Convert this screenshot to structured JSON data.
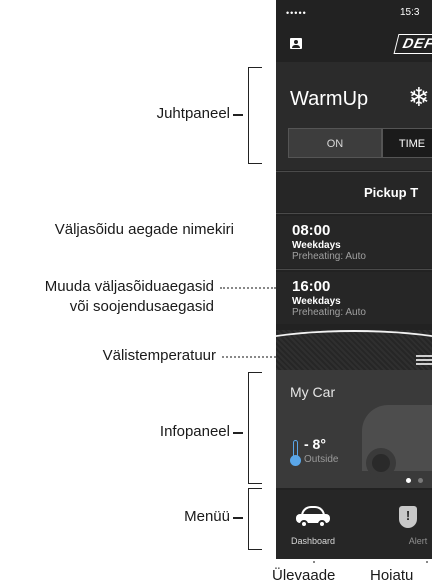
{
  "callouts": {
    "control_panel": "Juhtpaneel",
    "departure_list": "Väljasõidu aegade nimekiri",
    "edit_times_line1": "Muuda väljasõiduaegasid",
    "edit_times_line2": "või soojendusaegasid",
    "outside_temp": "Välistemperatuur",
    "info_panel": "Infopaneel",
    "menu": "Menüü",
    "overview": "Ülevaade",
    "alerts": "Hoiatu"
  },
  "phone": {
    "status": {
      "signal": "•••••",
      "time": "15:3"
    },
    "brand_logo": "DEF",
    "control": {
      "title": "WarmUp",
      "on_label": "ON",
      "timer_label": "TIME"
    },
    "pickup_header": "Pickup T",
    "departures": [
      {
        "time": "08:00",
        "days": "Weekdays",
        "preheat": "Preheating: Auto"
      },
      {
        "time": "16:00",
        "days": "Weekdays",
        "preheat": "Preheating: Auto"
      }
    ],
    "info": {
      "car_name": "My Car",
      "temperature": "- 8°",
      "temperature_caption": "Outside"
    },
    "menu": {
      "dashboard_label": "Dashboard",
      "alerts_label": "Alert"
    }
  },
  "colors": {
    "phone_bg": "#222222",
    "accent_thermo": "#5aa6e8"
  }
}
